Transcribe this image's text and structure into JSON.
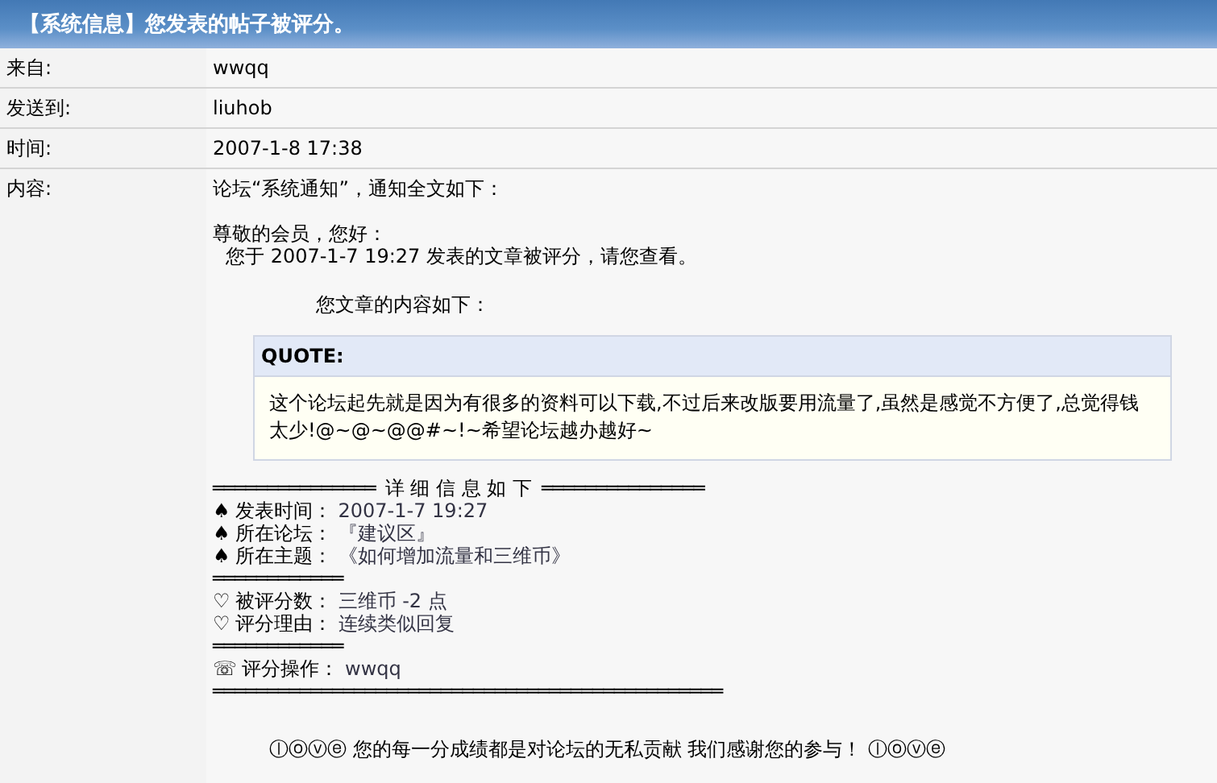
{
  "title": "【系统信息】您发表的帖子被评分。",
  "fields": [
    {
      "label": "来自:",
      "value": "wwqq"
    },
    {
      "label": "发送到:",
      "value": "liuhob"
    },
    {
      "label": "时间:",
      "value": "2007-1-8 17:38"
    }
  ],
  "content": {
    "label": "内容:",
    "intro": "论坛“系统通知”，通知全文如下：",
    "greeting": "尊敬的会员，您好：",
    "notice": "您于 2007-1-7 19:27 发表的文章被评分，请您查看。",
    "lead": "您文章的内容如下：",
    "quote": {
      "heading": "QUOTE:",
      "text": "这个论坛起先就是因为有很多的资料可以下载,不过后来改版要用流量了,虽然是感觉不方便了,总觉得钱太少!@~@~@@#~!~希望论坛越办越好~"
    },
    "details": [
      {
        "kind": "heading",
        "left": "═══════════════",
        "text": "详 细 信 息 如 下",
        "right": "═══════════════"
      },
      {
        "kind": "item",
        "icon": "♠",
        "label": "发表时间：",
        "value": "2007-1-7 19:27"
      },
      {
        "kind": "item",
        "icon": "♠",
        "label": "所在论坛：",
        "value": "『建议区』"
      },
      {
        "kind": "item",
        "icon": "♠",
        "label": "所在主题：",
        "value": "《如何增加流量和三维币》"
      },
      {
        "kind": "rule",
        "text": "════════════"
      },
      {
        "kind": "item",
        "icon": "♡",
        "label": "被评分数：",
        "value": "三维币 -2 点"
      },
      {
        "kind": "item",
        "icon": "♡",
        "label": "评分理由：",
        "value": "连续类似回复"
      },
      {
        "kind": "rule",
        "text": "════════════"
      },
      {
        "kind": "item",
        "icon": "☏",
        "label": "评分操作：",
        "value": "wwqq"
      },
      {
        "kind": "rule",
        "text": "═══════════════════════════════════════════════"
      }
    ],
    "footer": "ⓛⓞⓥⓔ  您的每一分成绩都是对论坛的无私贡献  我们感谢您的参与！ ⓛⓞⓥⓔ"
  }
}
